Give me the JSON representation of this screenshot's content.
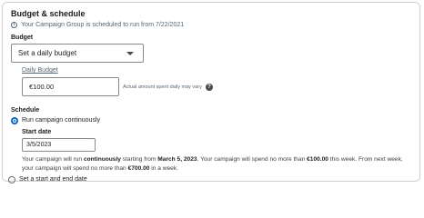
{
  "section": {
    "title": "Budget & schedule",
    "info_text": "Your Campaign Group is scheduled to run from 7/22/2021"
  },
  "budget": {
    "label": "Budget",
    "type_selected": "Set a daily budget",
    "daily_label": "Daily Budget",
    "daily_value": "€100.00",
    "hint": "Actual amount spent daily may vary"
  },
  "schedule": {
    "label": "Schedule",
    "option_continuous": "Run campaign continuously",
    "option_continuous_selected": true,
    "start_date_label": "Start date",
    "start_date_value": "3/5/2023",
    "summary": {
      "p1": "Your campaign will run ",
      "b1": "continuously",
      "p2": " starting from ",
      "b2": "March 5, 2023",
      "p3": ". Your campaign will spend no more than ",
      "b3": "€100.00",
      "p4": " this week. From next week, your campaign will spend no more than ",
      "b4": "€700.00",
      "p5": " in a week."
    },
    "option_start_end": "Set a start and end date",
    "option_start_end_selected": false
  },
  "colors": {
    "accent": "#0a66c2",
    "muted_text": "#566573",
    "border": "#8a8a8a"
  }
}
